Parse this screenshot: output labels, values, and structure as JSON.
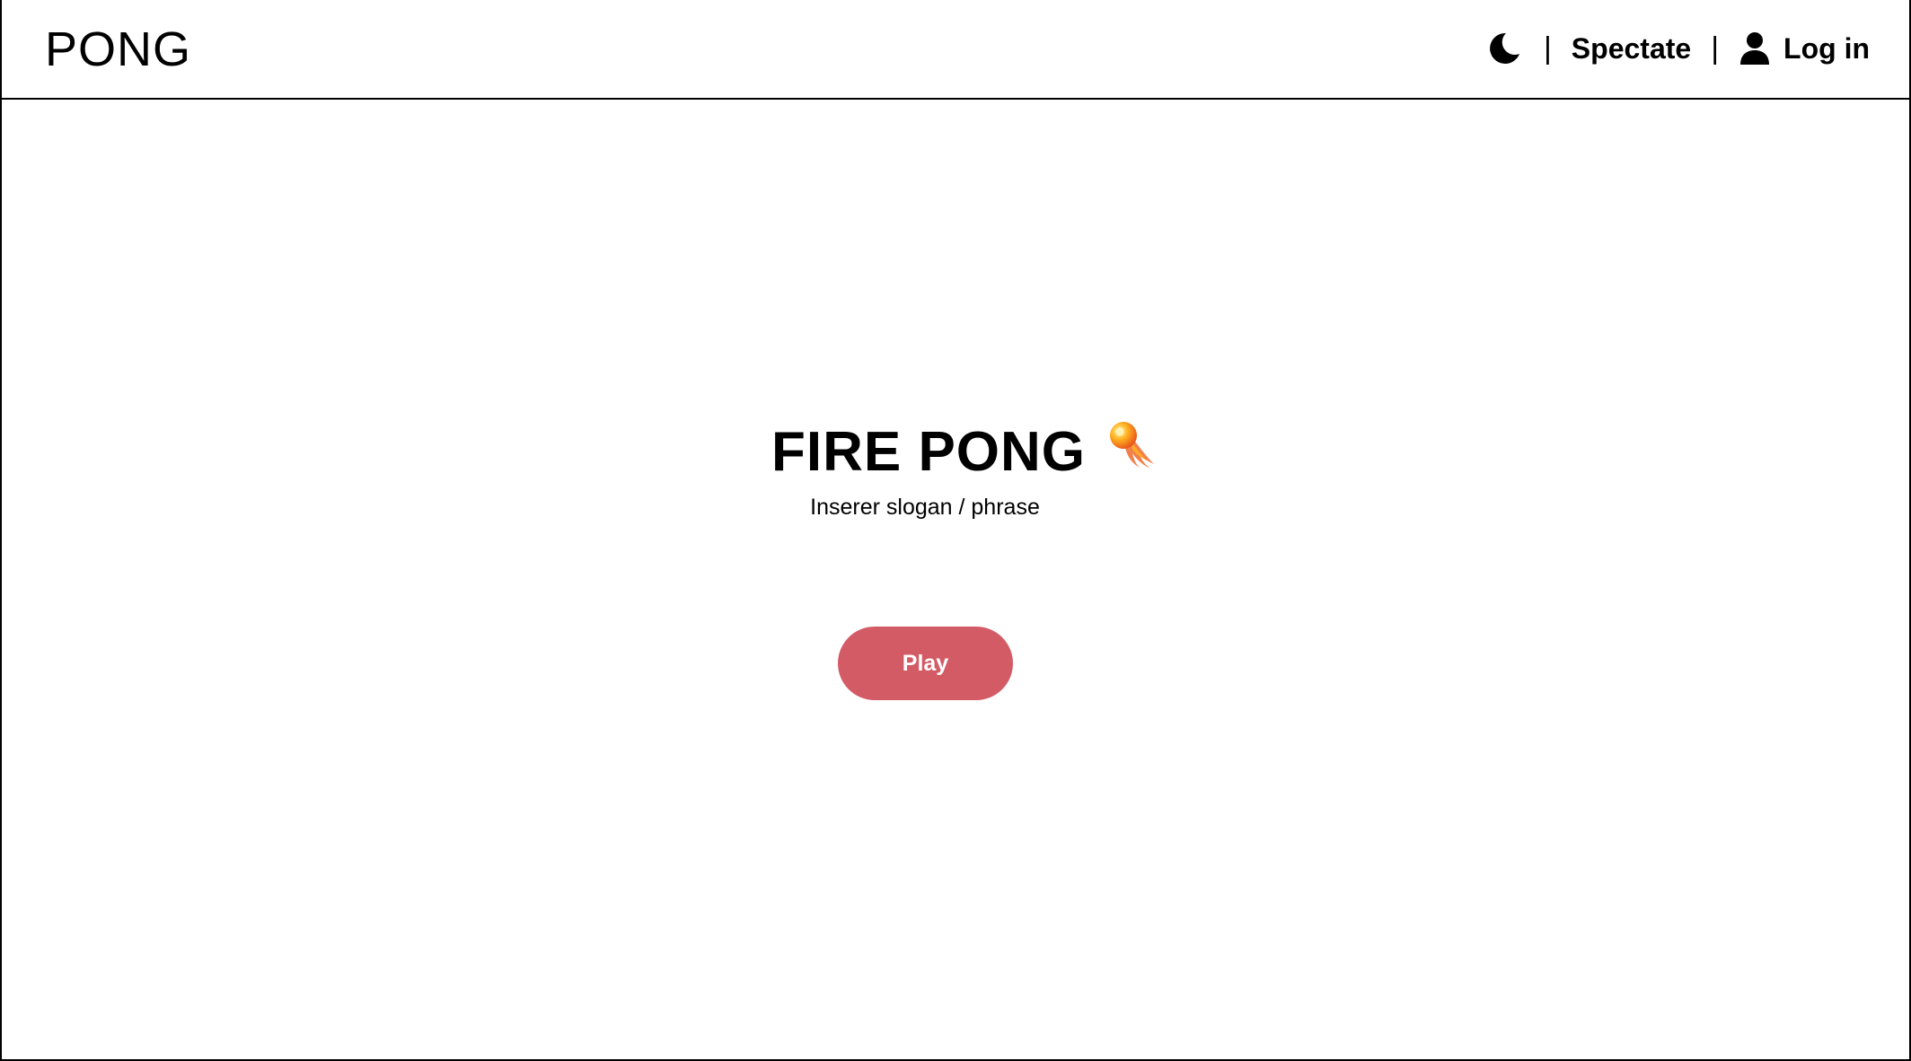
{
  "header": {
    "brand": "PONG",
    "theme_toggle_icon": "moon-icon",
    "separator": "|",
    "spectate_label": "Spectate",
    "login_icon": "user-icon",
    "login_label": "Log in"
  },
  "hero": {
    "title": "FIRE PONG",
    "title_icon": "fireball-icon",
    "slogan": "Inserer slogan / phrase",
    "play_label": "Play"
  },
  "colors": {
    "accent": "#d35b65",
    "text": "#000000",
    "background": "#ffffff"
  }
}
